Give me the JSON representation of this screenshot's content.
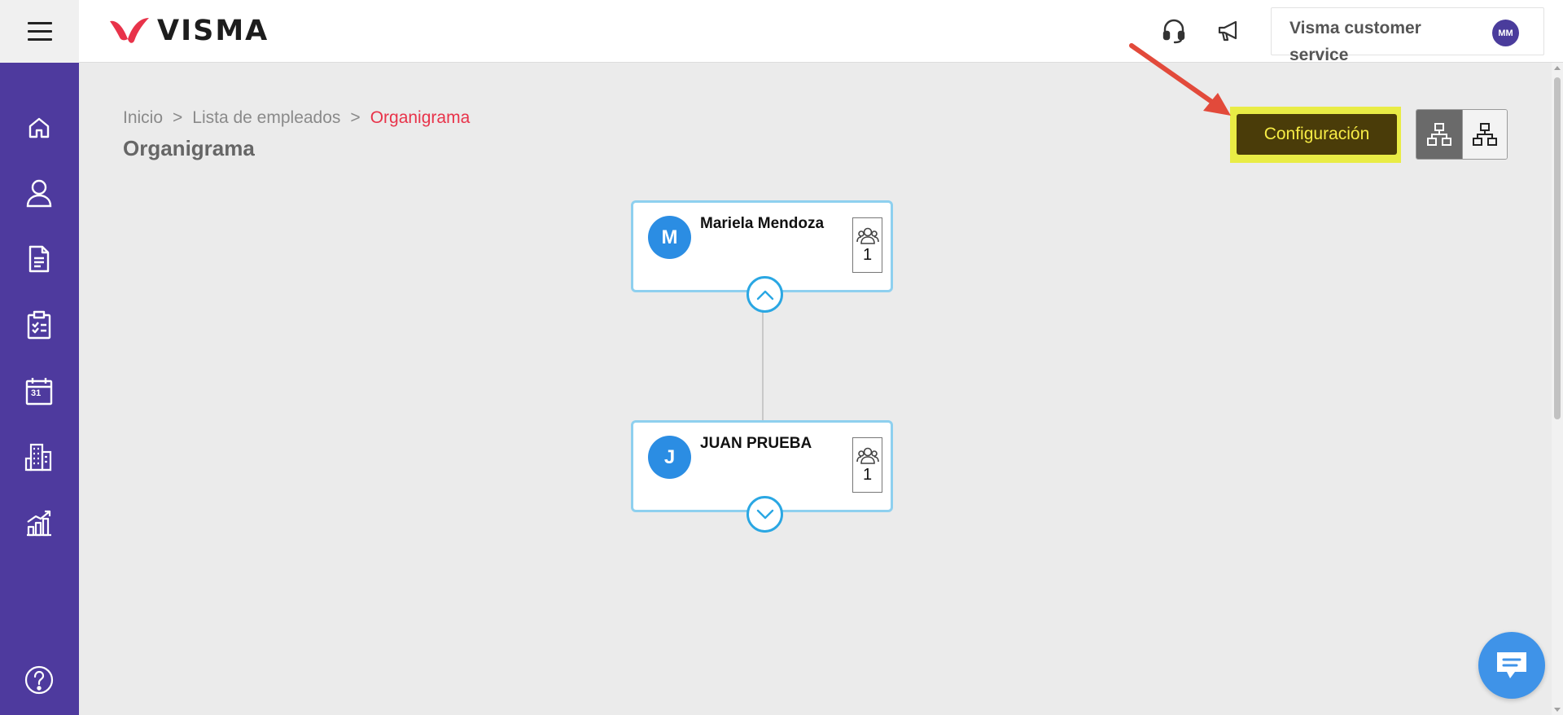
{
  "app": {
    "logo_text": "VISMA"
  },
  "header": {
    "account_name": "Visma customer service",
    "account_initials": "MM"
  },
  "sidebar": {
    "items": [
      {
        "icon": "home-icon"
      },
      {
        "icon": "user-icon"
      },
      {
        "icon": "document-icon"
      },
      {
        "icon": "clipboard-check-icon"
      },
      {
        "icon": "calendar-icon",
        "day": "31"
      },
      {
        "icon": "building-icon"
      },
      {
        "icon": "growth-chart-icon"
      }
    ],
    "help_icon": "help-icon"
  },
  "breadcrumb": {
    "items": [
      "Inicio",
      "Lista de empleados",
      "Organigrama"
    ],
    "separator": ">"
  },
  "page": {
    "title": "Organigrama"
  },
  "toolbar": {
    "config_label": "Configuración"
  },
  "org_chart": {
    "nodes": [
      {
        "initial": "M",
        "name": "Mariela Mendoza",
        "count": "1",
        "toggle": "collapse"
      },
      {
        "initial": "J",
        "name": "JUAN PRUEBA",
        "count": "1",
        "toggle": "expand"
      }
    ]
  },
  "colors": {
    "sidebar": "#4e3a9e",
    "accent_red": "#e8334a",
    "node_border": "#8ed0ef",
    "avatar_blue": "#2b8de3",
    "config_bg": "#4a3c09",
    "config_text": "#f7ec45",
    "highlight": "#e9ec45"
  }
}
